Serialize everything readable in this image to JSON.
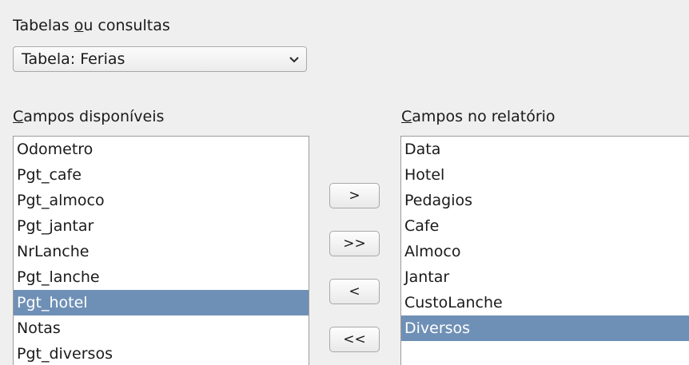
{
  "tables_label": {
    "pre": "Tabelas ",
    "mnemonic": "o",
    "post": "u consultas"
  },
  "table_select": {
    "value": "Tabela: Ferias",
    "icon": "chevron-down-icon"
  },
  "available_label": {
    "mnemonic": "C",
    "rest": "ampos disponíveis"
  },
  "report_label": {
    "mnemonic": "C",
    "rest": "ampos no relatório"
  },
  "available_fields": [
    "Odometro",
    "Pgt_cafe",
    "Pgt_almoco",
    "Pgt_jantar",
    "NrLanche",
    "Pgt_lanche",
    "Pgt_hotel",
    "Notas",
    "Pgt_diversos"
  ],
  "available_selected": "Pgt_hotel",
  "report_fields": [
    "Data",
    "Hotel",
    "Pedagios",
    "Cafe",
    "Almoco",
    "Jantar",
    "CustoLanche",
    "Diversos"
  ],
  "report_selected": "Diversos",
  "buttons": {
    "move_one": ">",
    "move_all": ">>",
    "remove_one": "<",
    "remove_all": "<<"
  },
  "colors": {
    "selection": "#6f90b6",
    "background": "#efefef"
  }
}
